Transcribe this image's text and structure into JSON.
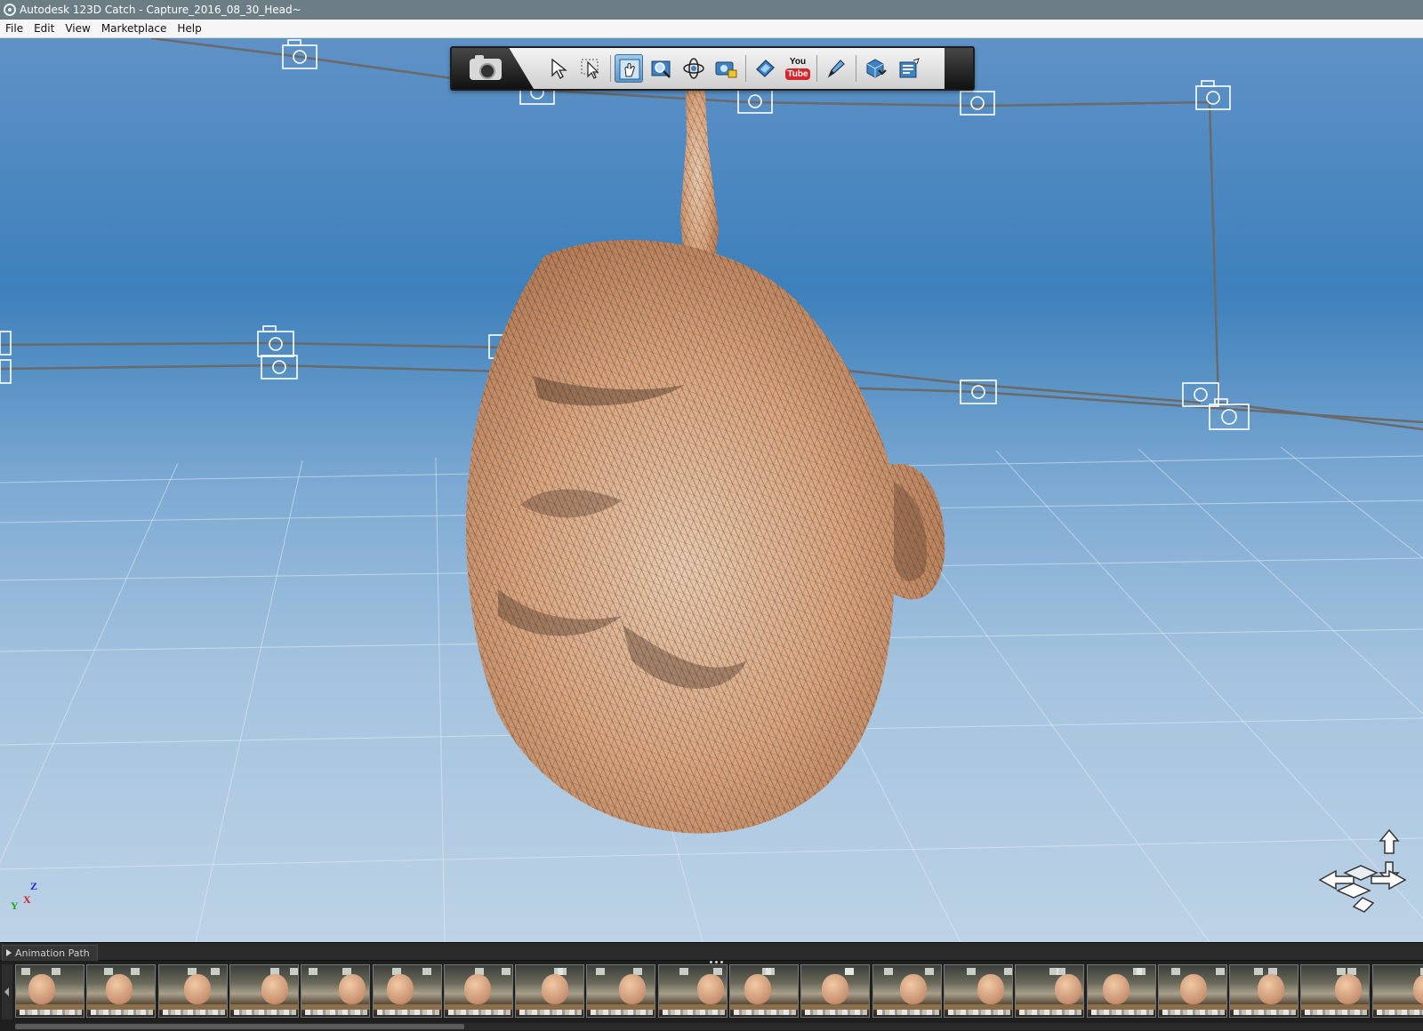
{
  "window": {
    "title": "Autodesk 123D Catch - Capture_2016_08_30_Head~",
    "icon": "autodesk-123d-catch-icon"
  },
  "menu": {
    "items": [
      "File",
      "Edit",
      "View",
      "Marketplace",
      "Help"
    ]
  },
  "toolbar": {
    "capture_icon": "camera-icon",
    "tools": [
      {
        "name": "select-tool",
        "icon": "arrow-cursor-icon"
      },
      {
        "name": "lasso-select-tool",
        "icon": "lasso-cursor-icon"
      },
      {
        "name": "pan-tool",
        "icon": "hand-icon",
        "active": true
      },
      {
        "name": "zoom-tool",
        "icon": "magnifier-icon"
      },
      {
        "name": "orbit-tool",
        "icon": "orbit-icon"
      },
      {
        "name": "camera-lock-tool",
        "icon": "camera-lock-icon"
      },
      {
        "name": "animation-tool",
        "icon": "film-icon"
      },
      {
        "name": "youtube-export",
        "icon": "youtube-icon"
      },
      {
        "name": "edit-tool",
        "icon": "pen-icon"
      },
      {
        "name": "mesh-export",
        "icon": "cube-mesh-icon"
      },
      {
        "name": "output-tool",
        "icon": "document-icon"
      }
    ],
    "youtube_top": "You",
    "youtube_bottom": "Tube"
  },
  "axes": {
    "z": "Z",
    "y": "Y",
    "x": "X"
  },
  "navigation": {
    "icon": "navigation-cube-icon"
  },
  "animation_panel": {
    "tab_label": "Animation Path",
    "thumbnail_count": 20
  }
}
